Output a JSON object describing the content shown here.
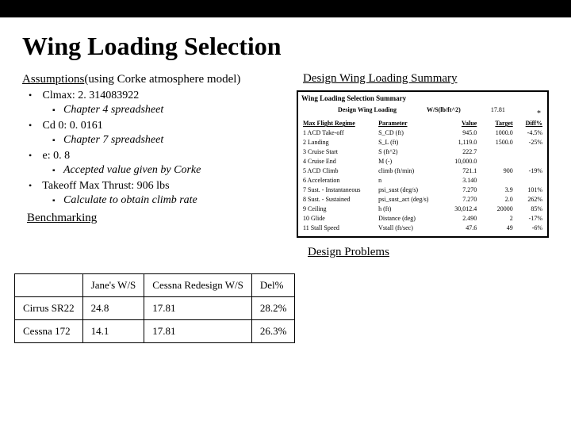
{
  "title": "Wing Loading Selection",
  "assumptions": {
    "label": "Assumptions",
    "tail": "(using Corke atmosphere model)",
    "items": [
      {
        "text": "Clmax: 2. 314083922",
        "sub": "Chapter 4 spreadsheet"
      },
      {
        "text": "Cd 0: 0. 0161",
        "sub": "Chapter 7 spreadsheet"
      },
      {
        "text": "e: 0. 8",
        "sub": "Accepted value given by Corke"
      },
      {
        "text": "Takeoff Max Thrust: 906 lbs",
        "sub": "Calculate to obtain climb rate"
      }
    ],
    "benchmarking": "Benchmarking"
  },
  "summary": {
    "heading": "Design Wing Loading Summary",
    "box_title": "Wing Loading Selection Summary",
    "design_label": "Design Wing Loading",
    "ws_label": "W/S(lb/ft^2)",
    "ws_value": "17.81",
    "star": "*",
    "cols": [
      "Max Flight Regime",
      "Parameter",
      "Value",
      "Target",
      "Diff%"
    ],
    "rows": [
      [
        "1 ACD Take-off",
        "S_CD (ft)",
        "945.0",
        "1000.0",
        "-4.5%"
      ],
      [
        "2 Landing",
        "S_L (ft)",
        "1,119.0",
        "1500.0",
        "-25%"
      ],
      [
        "3 Cruise Start",
        "S (ft^2)",
        "222.7",
        "",
        ""
      ],
      [
        "4 Cruise End",
        "M (-)",
        "10,000.0",
        "",
        ""
      ],
      [
        "5 ACD Climb",
        "climb (ft/min)",
        "721.1",
        "900",
        "-19%"
      ],
      [
        "6 Acceleration",
        "n",
        "3.140",
        "",
        ""
      ],
      [
        "7 Sust. - Instantaneous",
        "psi_sust (deg/s)",
        "7.270",
        "3.9",
        "101%"
      ],
      [
        "8 Sust. - Sustained",
        "psi_sust_act (deg/s)",
        "7.270",
        "2.0",
        "262%"
      ],
      [
        "9 Ceiling",
        "h (ft)",
        "30,012.4",
        "20000",
        "85%"
      ],
      [
        "10 Glide",
        "Distance (deg)",
        "2.490",
        "2",
        "-17%"
      ],
      [
        "11 Stall Speed",
        "Vstall (ft/sec)",
        "47.6",
        "49",
        "-6%"
      ]
    ],
    "problems": "Design Problems"
  },
  "bench": {
    "headers": [
      "",
      "Jane's W/S",
      "Cessna Redesign W/S",
      "Del%"
    ],
    "rows": [
      [
        "Cirrus SR22",
        "24.8",
        "17.81",
        "28.2%"
      ],
      [
        "Cessna 172",
        "14.1",
        "17.81",
        "26.3%"
      ]
    ]
  }
}
